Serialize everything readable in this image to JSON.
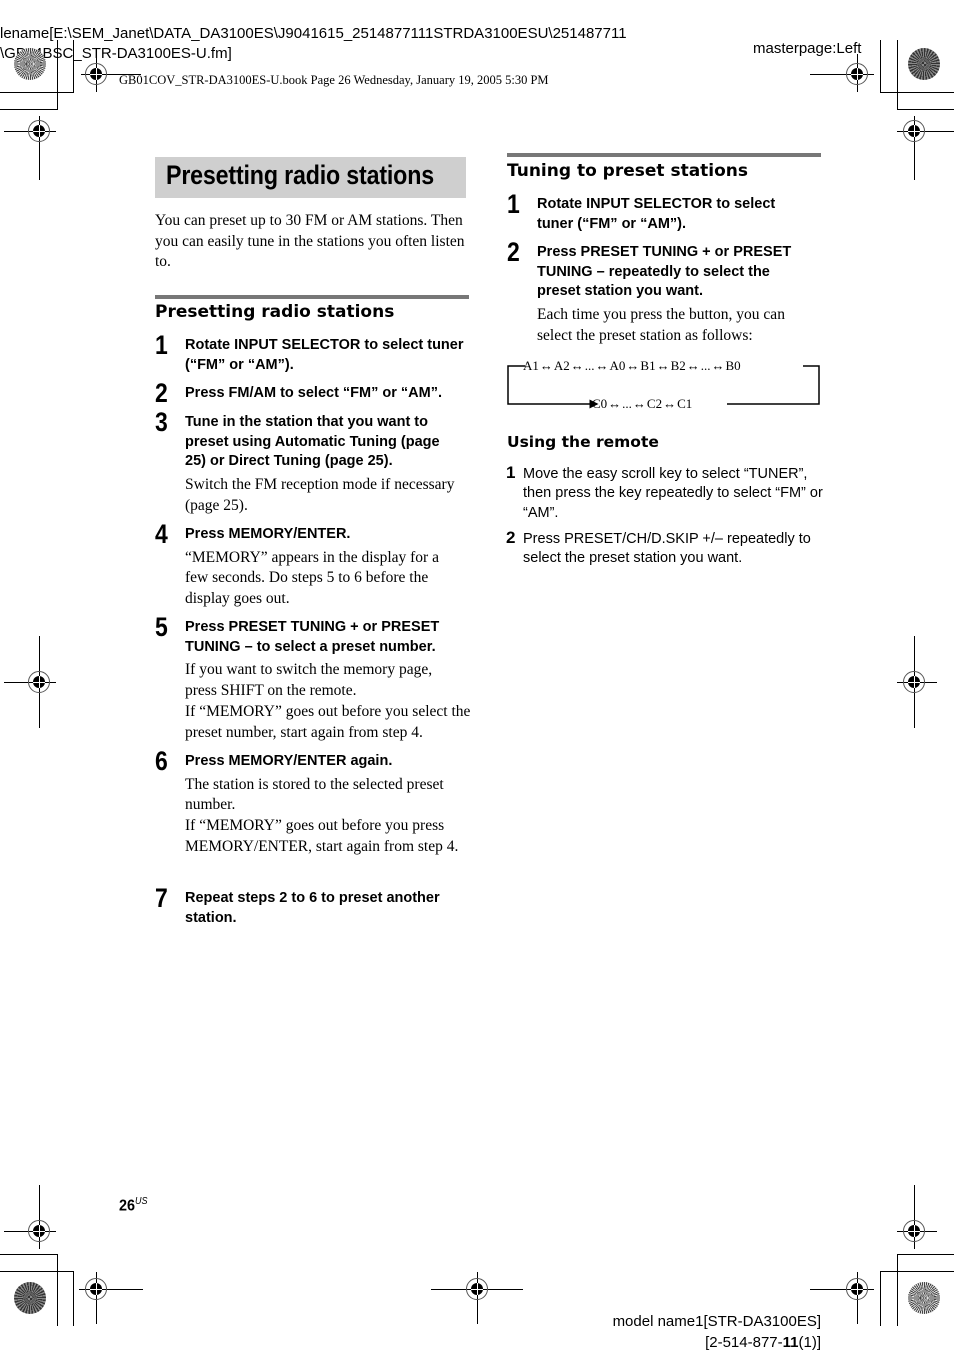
{
  "meta": {
    "filename_line1": "lename[E:\\SEM_Janet\\DATA_DA3100ES\\J9041615_2514877111STRDA3100ESU\\251487711",
    "filename_line2": "\\GB04BSC_STR-DA3100ES-U.fm]",
    "book_line": "GB01COV_STR-DA3100ES-U.book  Page 26  Wednesday, January 19, 2005  5:30 PM",
    "masterpage": "masterpage:Left"
  },
  "left_column": {
    "title": "Presetting radio stations",
    "intro": "You can preset up to 30 FM or AM stations. Then you can easily tune in the stations you often listen to.",
    "section_heading": "Presetting radio stations",
    "steps": [
      {
        "num": "1",
        "title": "Rotate INPUT SELECTOR to select tuner (“FM” or “AM”).",
        "notes": []
      },
      {
        "num": "2",
        "title": "Press FM/AM to select “FM” or “AM”.",
        "notes": []
      },
      {
        "num": "3",
        "title": "Tune in the station that you want to preset using Automatic Tuning (page 25) or Direct Tuning (page 25).",
        "notes": [
          "Switch the FM reception mode if necessary (page 25)."
        ]
      },
      {
        "num": "4",
        "title": "Press MEMORY/ENTER.",
        "notes": [
          "“MEMORY” appears in the display for a few seconds. Do steps 5 to 6 before the display goes out."
        ]
      },
      {
        "num": "5",
        "title": "Press PRESET TUNING + or PRESET TUNING – to select a preset number.",
        "notes": [
          "If you want to switch the memory page, press SHIFT on the remote.",
          "If “MEMORY” goes out before you select the preset number, start again from step 4."
        ]
      },
      {
        "num": "6",
        "title": "Press MEMORY/ENTER again.",
        "notes": [
          "The station is stored to the selected preset number.",
          "If “MEMORY” goes out before you press MEMORY/ENTER, start again from step 4."
        ]
      },
      {
        "num": "7",
        "title": "Repeat steps 2 to 6 to preset another station.",
        "notes": []
      }
    ]
  },
  "right_column": {
    "section_heading": "Tuning to preset stations",
    "steps": [
      {
        "num": "1",
        "title": "Rotate INPUT SELECTOR to select tuner (“FM” or “AM”).",
        "notes": []
      },
      {
        "num": "2",
        "title": "Press PRESET TUNING + or PRESET TUNING – repeatedly to select the preset station you want.",
        "notes": [
          "Each time you press the button, you can select the preset station as follows:"
        ]
      }
    ],
    "preset_cycle": {
      "top_row": [
        "A1",
        "A2",
        "...",
        "A0",
        "B1",
        "B2",
        "...",
        "B0"
      ],
      "bottom_row": [
        "C0",
        "...",
        "C2",
        "C1"
      ]
    },
    "remote_heading": "Using the remote",
    "remote_steps": [
      {
        "num": "1",
        "text": "Move the easy scroll key to select “TUNER”, then press the key repeatedly to select “FM” or “AM”."
      },
      {
        "num": "2",
        "text": "Press PRESET/CH/D.SKIP +/– repeatedly to select the preset station you want."
      }
    ]
  },
  "footer": {
    "page_number": "26",
    "page_suffix": "US",
    "model_line": "model name1[STR-DA3100ES]",
    "code_prefix": "[2-514-877-",
    "code_bold": "11",
    "code_suffix": "(1)]"
  },
  "colors": {
    "title_bg": "#cfcfcf",
    "rule": "#777777",
    "text": "#000000"
  }
}
